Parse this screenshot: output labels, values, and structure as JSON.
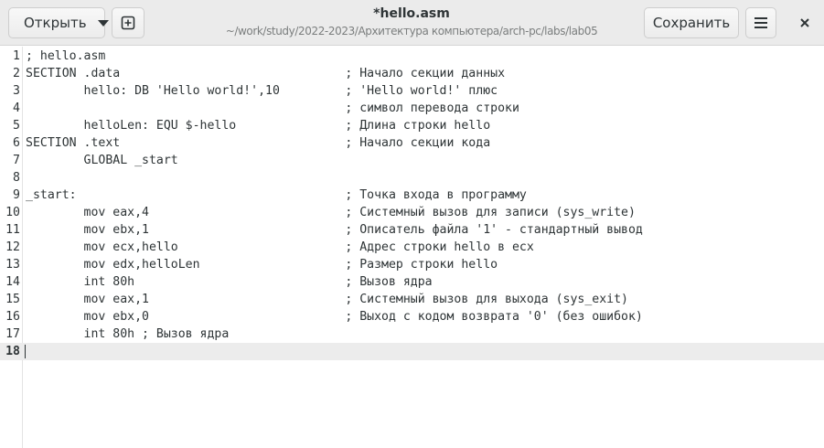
{
  "header": {
    "open_label": "Открыть",
    "title": "*hello.asm",
    "subtitle": "~/work/study/2022-2023/Архитектура компьютера/arch-pc/labs/lab05",
    "save_label": "Сохранить"
  },
  "icons": {
    "open_dropdown": "chevron-down-icon",
    "new_document": "new-tab-plus-icon",
    "menu": "hamburger-menu-icon",
    "close": "close-icon"
  },
  "editor": {
    "current_line": 18,
    "lines": [
      {
        "num": "1",
        "text": "; hello.asm"
      },
      {
        "num": "2",
        "text": "SECTION .data                               ; Начало секции данных"
      },
      {
        "num": "3",
        "text": "        hello: DB 'Hello world!',10         ; 'Hello world!' плюс"
      },
      {
        "num": "4",
        "text": "                                            ; символ перевода строки"
      },
      {
        "num": "5",
        "text": "        helloLen: EQU $-hello               ; Длина строки hello"
      },
      {
        "num": "6",
        "text": "SECTION .text                               ; Начало секции кода"
      },
      {
        "num": "7",
        "text": "        GLOBAL _start"
      },
      {
        "num": "8",
        "text": ""
      },
      {
        "num": "9",
        "text": "_start:                                     ; Точка входа в программу"
      },
      {
        "num": "10",
        "text": "        mov eax,4                           ; Системный вызов для записи (sys_write)"
      },
      {
        "num": "11",
        "text": "        mov ebx,1                           ; Описатель файла '1' - стандартный вывод"
      },
      {
        "num": "12",
        "text": "        mov ecx,hello                       ; Адрес строки hello в ecx"
      },
      {
        "num": "13",
        "text": "        mov edx,helloLen                    ; Размер строки hello"
      },
      {
        "num": "14",
        "text": "        int 80h                             ; Вызов ядра"
      },
      {
        "num": "15",
        "text": "        mov eax,1                           ; Системный вызов для выхода (sys_exit)"
      },
      {
        "num": "16",
        "text": "        mov ebx,0                           ; Выход с кодом возврата '0' (без ошибок)"
      },
      {
        "num": "17",
        "text": "        int 80h ; Вызов ядра"
      },
      {
        "num": "18",
        "text": ""
      }
    ]
  }
}
